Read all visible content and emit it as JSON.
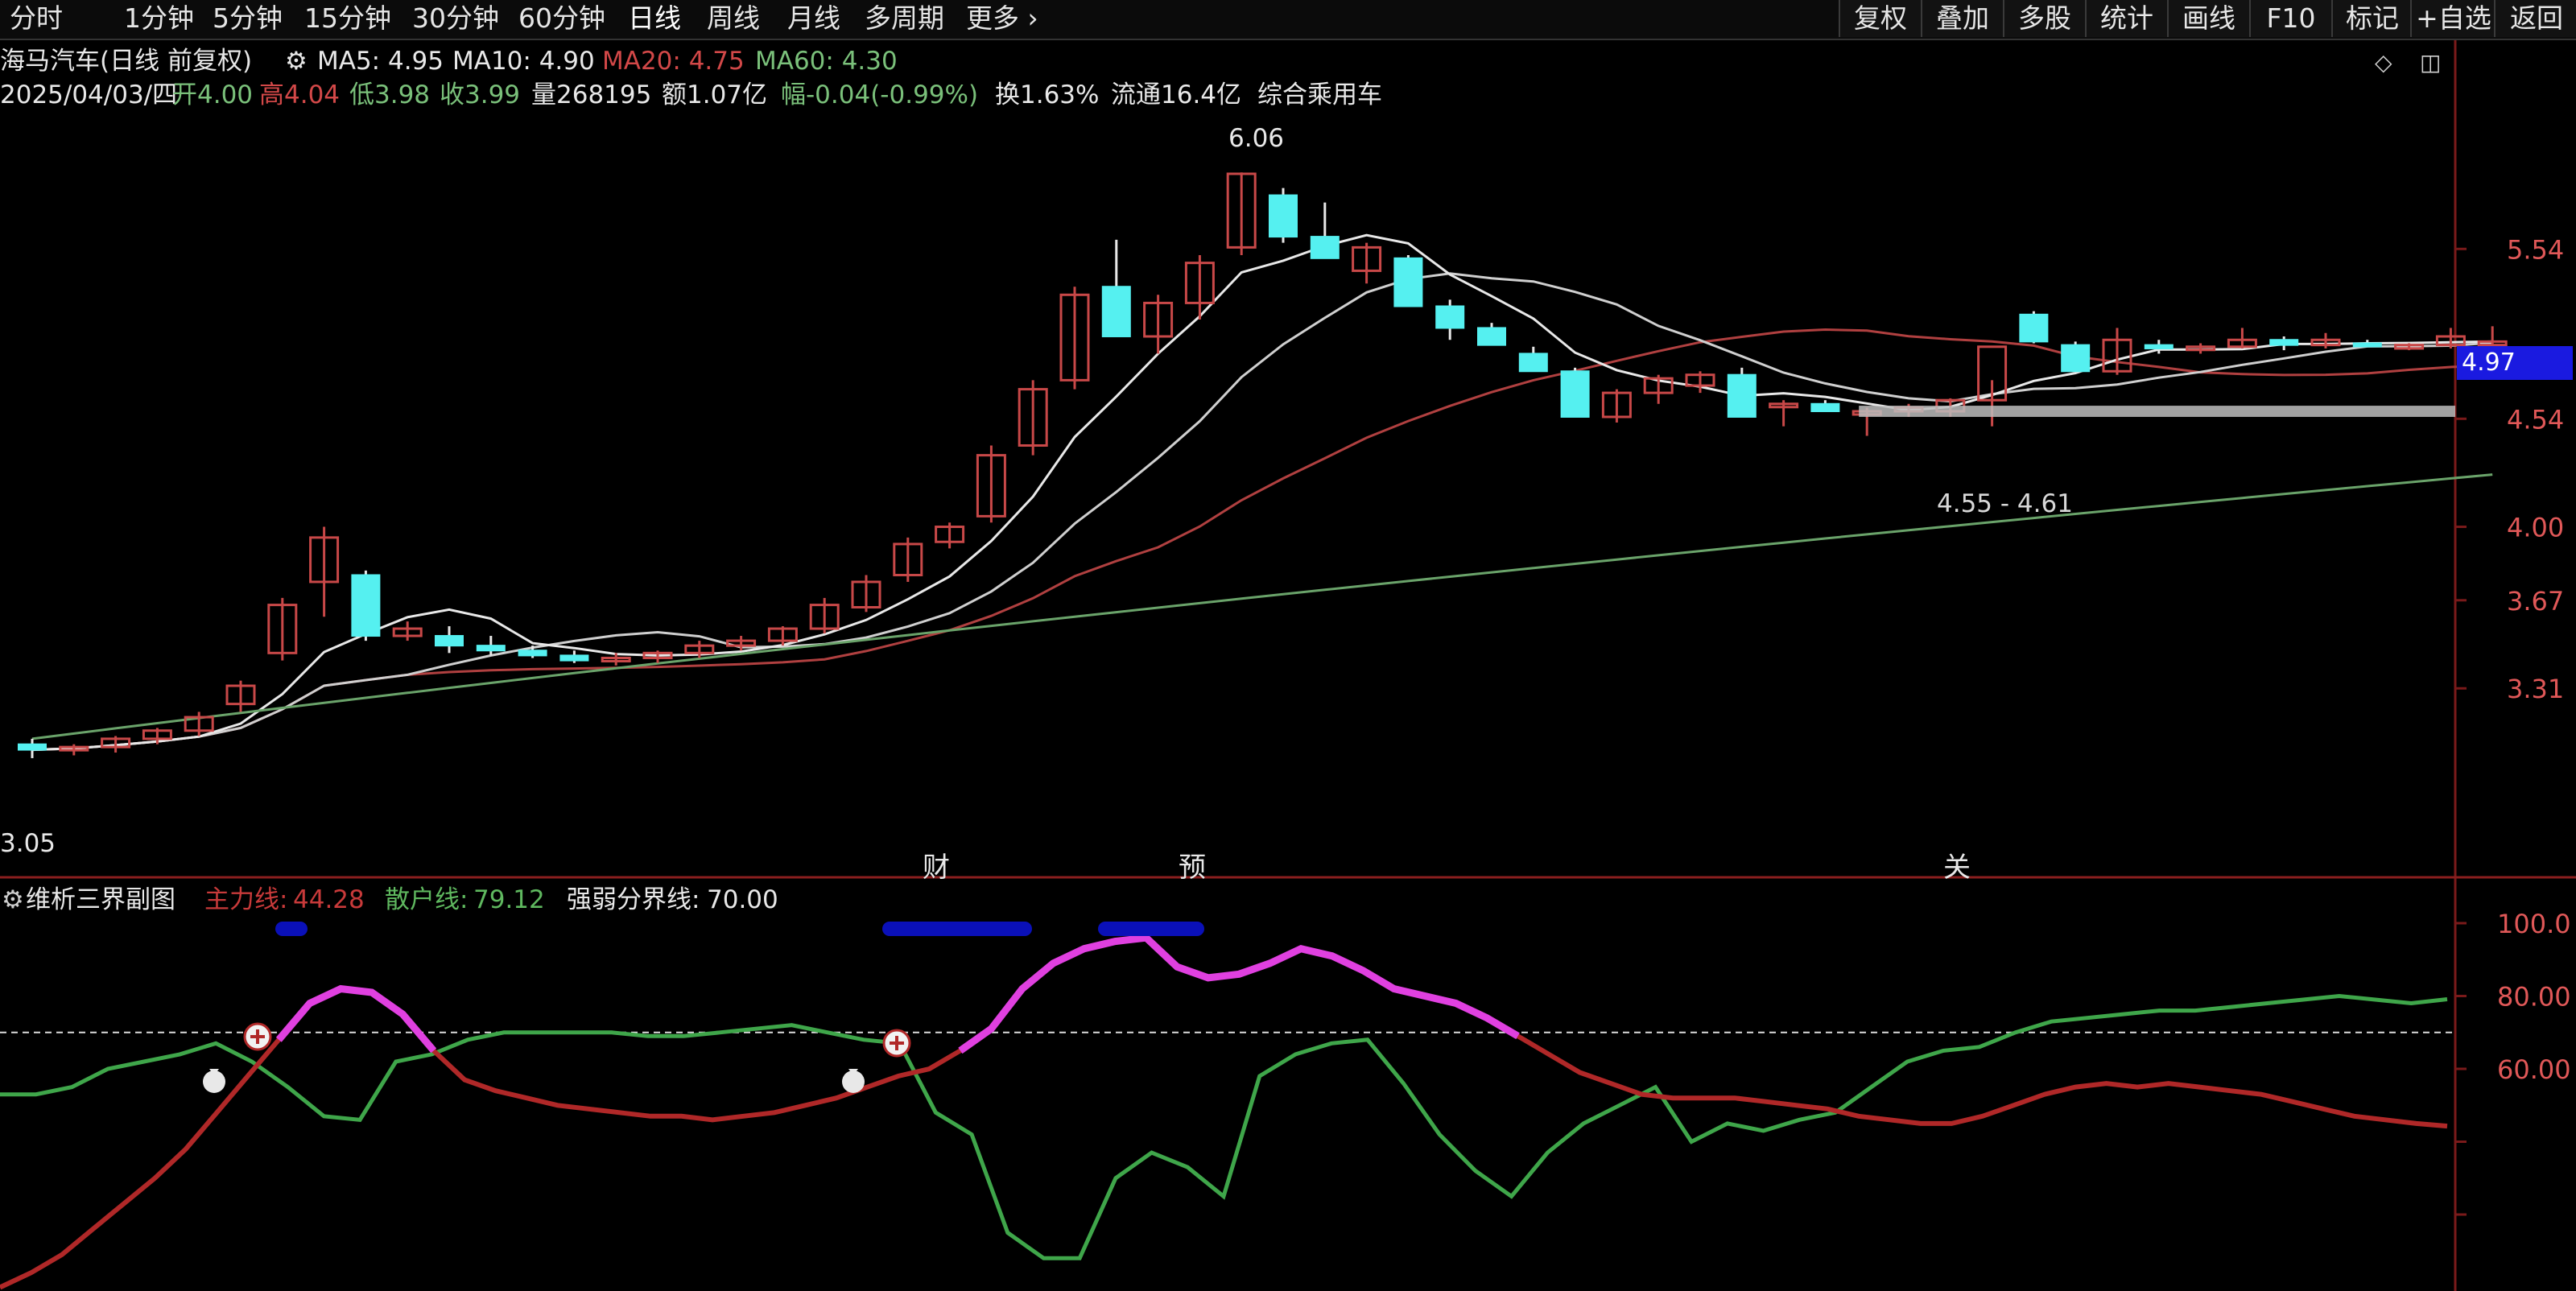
{
  "toolbar": {
    "timeframes": [
      "分时",
      "1分钟",
      "5分钟",
      "15分钟",
      "30分钟",
      "60分钟",
      "日线",
      "周线",
      "月线",
      "多周期",
      "更多 ›"
    ],
    "right_buttons": [
      "复权",
      "叠加",
      "多股",
      "统计",
      "画线",
      "F10",
      "标记",
      "+自选",
      "返回"
    ]
  },
  "header": {
    "title": "海马汽车(日线 前复权)",
    "ma5": "MA5: 4.95",
    "ma10": "MA10: 4.90",
    "ma20": "MA20: 4.75",
    "ma60": "MA60: 4.30",
    "date": "2025/04/03/四",
    "open": "开4.00",
    "high": "高4.04",
    "low": "低3.98",
    "close": "收3.99",
    "volume": "量268195",
    "amount": "额1.07亿",
    "change": "幅-0.04(-0.99%)",
    "turnover": "换1.63%",
    "float": "流通16.4亿",
    "sector": "综合乘用车"
  },
  "annotations": {
    "high_label": "6.06",
    "low_label": "3.05",
    "support_label": "4.55 - 4.61",
    "current_price": "4.97",
    "event_tags": [
      "财",
      "预",
      "关"
    ]
  },
  "indicator": {
    "name": "维析三界副图",
    "main_label": "主力线:",
    "main_value": "44.28",
    "retail_label": "散户线:",
    "retail_value": "79.12",
    "boundary_label": "强弱分界线:",
    "boundary_value": "70.00"
  },
  "colors": {
    "up": "#e05050",
    "down": "#55f0f0",
    "ma5": "#e8e8e8",
    "ma20": "#b04040",
    "ma60": "#6aa36a",
    "main_line": "#b02828",
    "main_strong": "#e040e0",
    "retail_line": "#3fa64a",
    "band": "#0a10b8",
    "grid_axis": "#7a1a1a"
  },
  "chart_data": [
    {
      "type": "candlestick",
      "yaxis_ticks": [
        "5.54",
        "4.54",
        "4.00",
        "3.67",
        "3.31"
      ],
      "ohlc": [
        [
          3.1,
          3.12,
          3.05,
          3.08
        ],
        [
          3.08,
          3.1,
          3.06,
          3.09
        ],
        [
          3.09,
          3.13,
          3.07,
          3.12
        ],
        [
          3.12,
          3.16,
          3.1,
          3.15
        ],
        [
          3.15,
          3.22,
          3.13,
          3.2
        ],
        [
          3.25,
          3.34,
          3.22,
          3.32
        ],
        [
          3.45,
          3.68,
          3.42,
          3.65
        ],
        [
          3.75,
          4.0,
          3.6,
          3.95
        ],
        [
          3.78,
          3.8,
          3.5,
          3.52
        ],
        [
          3.52,
          3.58,
          3.5,
          3.55
        ],
        [
          3.52,
          3.56,
          3.45,
          3.48
        ],
        [
          3.48,
          3.52,
          3.44,
          3.46
        ],
        [
          3.46,
          3.48,
          3.43,
          3.44
        ],
        [
          3.44,
          3.46,
          3.41,
          3.42
        ],
        [
          3.42,
          3.45,
          3.4,
          3.43
        ],
        [
          3.43,
          3.46,
          3.41,
          3.45
        ],
        [
          3.45,
          3.5,
          3.43,
          3.48
        ],
        [
          3.48,
          3.52,
          3.46,
          3.5
        ],
        [
          3.5,
          3.56,
          3.48,
          3.55
        ],
        [
          3.55,
          3.68,
          3.53,
          3.65
        ],
        [
          3.64,
          3.78,
          3.62,
          3.75
        ],
        [
          3.78,
          3.95,
          3.75,
          3.92
        ],
        [
          3.93,
          4.02,
          3.9,
          4.0
        ],
        [
          4.05,
          4.4,
          4.02,
          4.35
        ],
        [
          4.4,
          4.75,
          4.35,
          4.7
        ],
        [
          4.75,
          5.3,
          4.7,
          5.25
        ],
        [
          5.3,
          5.6,
          5.05,
          5.0
        ],
        [
          5.0,
          5.25,
          4.9,
          5.2
        ],
        [
          5.2,
          5.5,
          5.1,
          5.45
        ],
        [
          5.55,
          6.06,
          5.5,
          6.05
        ],
        [
          5.9,
          5.95,
          5.58,
          5.62
        ],
        [
          5.62,
          5.85,
          5.48,
          5.48
        ],
        [
          5.4,
          5.58,
          5.32,
          5.55
        ],
        [
          5.48,
          5.5,
          5.18,
          5.18
        ],
        [
          5.18,
          5.22,
          4.98,
          5.05
        ],
        [
          5.05,
          5.08,
          4.95,
          4.95
        ],
        [
          4.9,
          4.94,
          4.8,
          4.8
        ],
        [
          4.8,
          4.82,
          4.55,
          4.55
        ],
        [
          4.55,
          4.7,
          4.52,
          4.68
        ],
        [
          4.68,
          4.78,
          4.62,
          4.76
        ],
        [
          4.72,
          4.8,
          4.68,
          4.78
        ],
        [
          4.78,
          4.82,
          4.55,
          4.55
        ],
        [
          4.62,
          4.64,
          4.5,
          4.62
        ],
        [
          4.62,
          4.64,
          4.58,
          4.58
        ],
        [
          4.58,
          4.6,
          4.45,
          4.58
        ],
        [
          4.58,
          4.62,
          4.55,
          4.6
        ],
        [
          4.58,
          4.65,
          4.55,
          4.64
        ],
        [
          4.64,
          4.75,
          4.5,
          4.94
        ],
        [
          5.13,
          5.15,
          4.96,
          4.97
        ],
        [
          4.95,
          4.97,
          4.8,
          4.8
        ],
        [
          4.8,
          5.05,
          4.78,
          4.98
        ],
        [
          4.95,
          4.98,
          4.9,
          4.93
        ],
        [
          4.93,
          4.96,
          4.9,
          4.94
        ],
        [
          4.94,
          5.05,
          4.93,
          4.98
        ],
        [
          4.98,
          5.0,
          4.92,
          4.95
        ],
        [
          4.95,
          5.02,
          4.93,
          4.98
        ],
        [
          4.96,
          4.98,
          4.94,
          4.95
        ],
        [
          4.93,
          4.96,
          4.92,
          4.95
        ],
        [
          4.95,
          5.05,
          4.93,
          5.0
        ],
        [
          4.95,
          5.06,
          4.94,
          4.97
        ]
      ]
    },
    {
      "type": "line",
      "series": [
        {
          "name": "主力线",
          "values": [
            0,
            4,
            9,
            16,
            23,
            30,
            38,
            48,
            58,
            68,
            78,
            82,
            81,
            75,
            65,
            57,
            54,
            52,
            50,
            49,
            48,
            47,
            47,
            46,
            47,
            48,
            50,
            52,
            55,
            58,
            60,
            65,
            71,
            82,
            89,
            93,
            95,
            96,
            88,
            85,
            86,
            89,
            93,
            91,
            87,
            82,
            80,
            78,
            74,
            69,
            64,
            59,
            56,
            53,
            52,
            52,
            52,
            51,
            50,
            49,
            47,
            46,
            45,
            45,
            47,
            50,
            53,
            55,
            56,
            55,
            56,
            55,
            54,
            53,
            51,
            49,
            47,
            46,
            45,
            44.28
          ]
        },
        {
          "name": "散户线",
          "values": [
            53,
            53,
            55,
            60,
            62,
            64,
            67,
            62,
            55,
            47,
            46,
            62,
            64,
            68,
            70,
            70,
            70,
            70,
            69,
            69,
            70,
            71,
            72,
            70,
            68,
            67,
            48,
            42,
            15,
            8,
            8,
            30,
            37,
            33,
            25,
            58,
            64,
            67,
            68,
            56,
            42,
            32,
            25,
            37,
            45,
            50,
            55,
            40,
            45,
            43,
            46,
            48,
            55,
            62,
            65,
            66,
            70,
            73,
            74,
            75,
            76,
            76,
            77,
            78,
            79,
            80,
            79,
            78,
            79.12
          ]
        },
        {
          "name": "强弱分界线",
          "values": [
            70
          ]
        }
      ],
      "ylim": [
        0,
        110
      ],
      "yaxis_ticks": [
        "100.0",
        "80.00",
        "60.00"
      ]
    }
  ]
}
